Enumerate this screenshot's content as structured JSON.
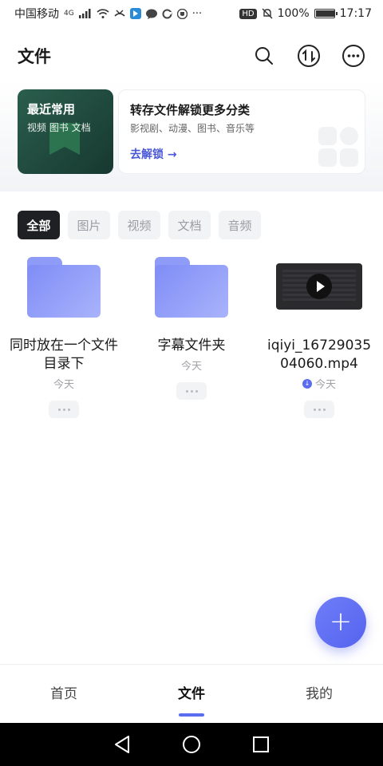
{
  "status_bar": {
    "carrier": "中国移动",
    "network": "4G",
    "hd_badge": "HD",
    "battery_percent": "100%",
    "battery_level": 1.0,
    "time": "17:17",
    "more": "···"
  },
  "header": {
    "title": "文件",
    "icons": [
      "search-icon",
      "transfer-icon",
      "more-icon"
    ]
  },
  "hero": {
    "recent_title": "最近常用",
    "recent_subtitle": "视频 图书 文档",
    "unlock_title": "转存文件解锁更多分类",
    "unlock_subtitle": "影视剧、动漫、图书、音乐等",
    "unlock_link": "去解锁 →"
  },
  "filters": [
    {
      "label": "全部",
      "active": true
    },
    {
      "label": "图片",
      "active": false
    },
    {
      "label": "视频",
      "active": false
    },
    {
      "label": "文档",
      "active": false
    },
    {
      "label": "音频",
      "active": false
    }
  ],
  "files": [
    {
      "name": "同时放在一个文件目录下",
      "meta": "今天",
      "type": "folder"
    },
    {
      "name": "字幕文件夹",
      "meta": "今天",
      "type": "folder"
    },
    {
      "name": "iqiyi_1672903504060.mp4",
      "meta": "今天",
      "type": "video"
    }
  ],
  "fab": {
    "icon": "plus-icon"
  },
  "tabbar": [
    {
      "label": "首页",
      "active": false
    },
    {
      "label": "文件",
      "active": true
    },
    {
      "label": "我的",
      "active": false
    }
  ],
  "accent_color": "#5b6cf0"
}
